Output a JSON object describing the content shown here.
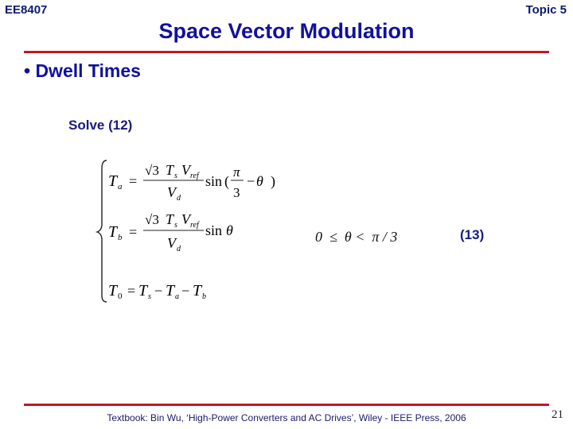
{
  "header": {
    "course": "EE8407",
    "topic": "Topic 5",
    "title": "Space Vector Modulation"
  },
  "content": {
    "bullet": "• Dwell Times",
    "solve_label": "Solve (12)",
    "equations": {
      "ta_lhs": "T",
      "ta_sub": "a",
      "tb_sub": "b",
      "t0_sub": "0",
      "sqrt3": "√3",
      "ts": "T",
      "s_sub": "s",
      "vref": "V",
      "ref_sub": "ref",
      "vd": "V",
      "d_sub": "d",
      "sin": "sin",
      "pi": "π",
      "three": "3",
      "theta": "θ",
      "eq": "=",
      "minus": "−",
      "condition": "0  ≤  θ <  π / 3"
    },
    "equation_number": "(13)"
  },
  "footer": {
    "citation": "Textbook: Bin Wu, ‘High-Power Converters and AC Drives’, Wiley - IEEE Press, 2006",
    "page_number": "21"
  }
}
